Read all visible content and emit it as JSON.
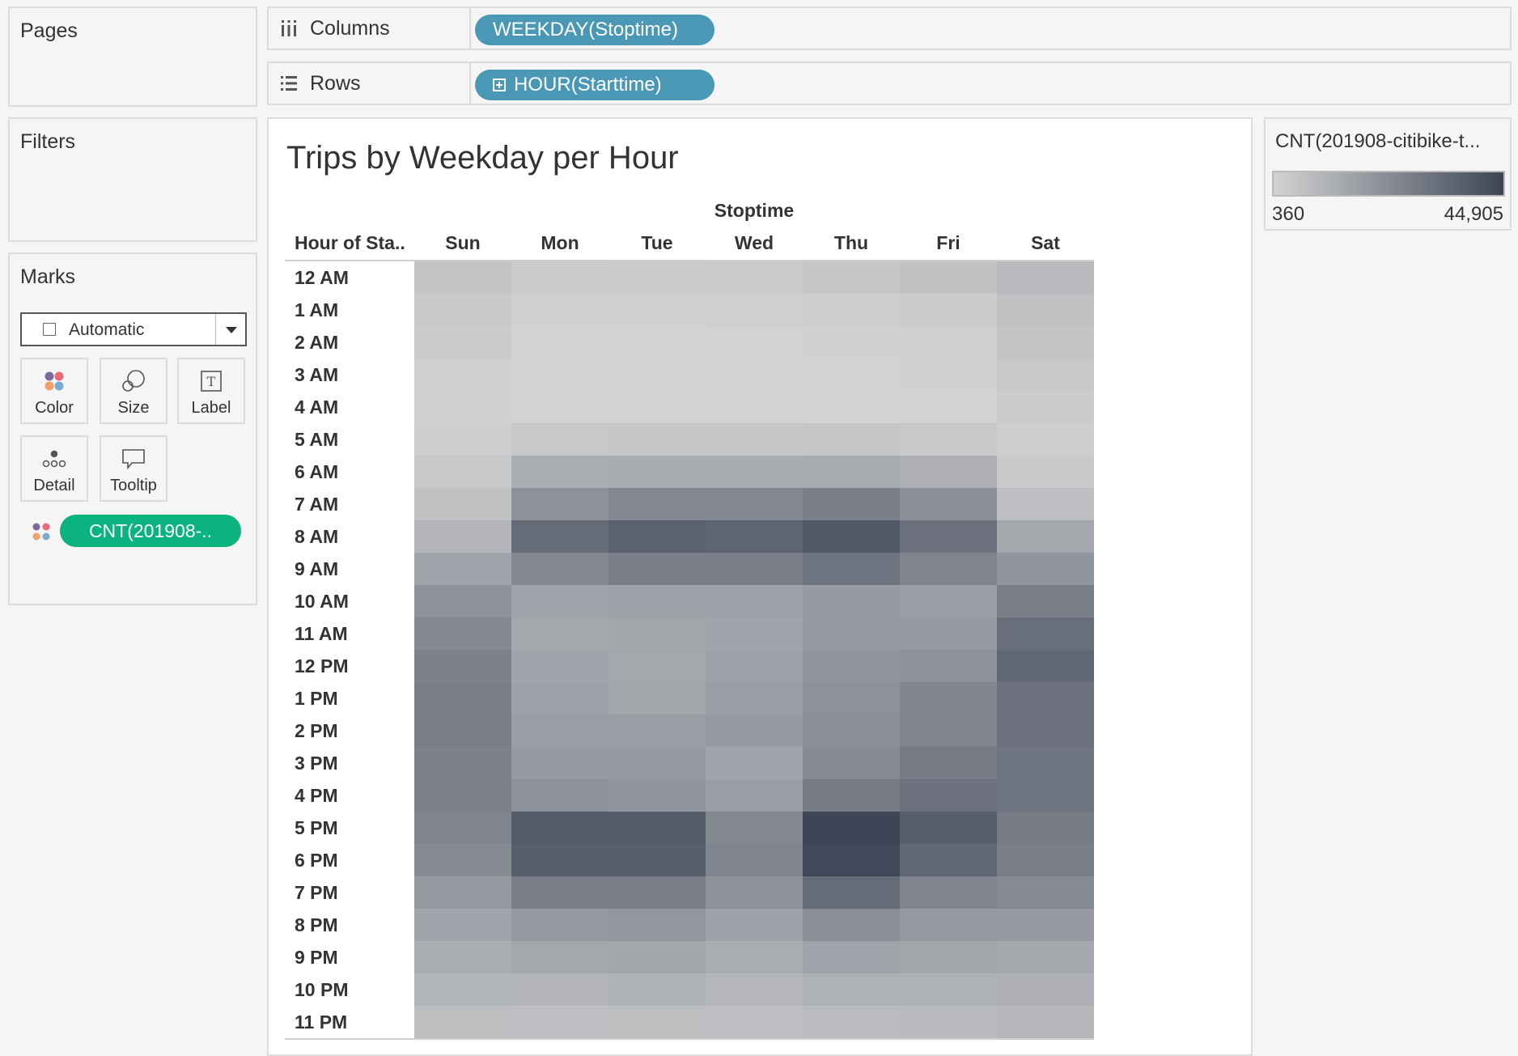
{
  "panels": {
    "pages": "Pages",
    "filters": "Filters",
    "marks": "Marks"
  },
  "shelves": {
    "columns": {
      "label": "Columns",
      "pill": "WEEKDAY(Stoptime)"
    },
    "rows": {
      "label": "Rows",
      "pill": "HOUR(Starttime)"
    }
  },
  "marks": {
    "type": "Automatic",
    "buttons": [
      "Color",
      "Size",
      "Label",
      "Detail",
      "Tooltip"
    ],
    "field_pill": "CNT(201908-.."
  },
  "legend": {
    "title": "CNT(201908-citibike-t...",
    "min_label": "360",
    "max_label": "44,905",
    "min_color": "#d2d3d3",
    "max_color": "#3d4556"
  },
  "chart_data": {
    "type": "heatmap",
    "title": "Trips by Weekday per Hour",
    "column_header": "Stoptime",
    "row_header": "Hour of Sta..",
    "x": [
      "Sun",
      "Mon",
      "Tue",
      "Wed",
      "Thu",
      "Fri",
      "Sat"
    ],
    "y": [
      "12 AM",
      "1 AM",
      "2 AM",
      "3 AM",
      "4 AM",
      "5 AM",
      "6 AM",
      "7 AM",
      "8 AM",
      "9 AM",
      "10 AM",
      "11 AM",
      "12 PM",
      "1 PM",
      "2 PM",
      "3 PM",
      "4 PM",
      "5 PM",
      "6 PM",
      "7 PM",
      "8 PM",
      "9 PM",
      "10 PM",
      "11 PM"
    ],
    "value_range": [
      360,
      44905
    ],
    "values": [
      [
        5000,
        2600,
        2900,
        3300,
        4500,
        5800,
        8500
      ],
      [
        3600,
        1200,
        1300,
        1500,
        2000,
        2800,
        6400
      ],
      [
        2500,
        700,
        700,
        800,
        1100,
        1500,
        5000
      ],
      [
        1700,
        450,
        420,
        500,
        700,
        900,
        3700
      ],
      [
        1400,
        600,
        550,
        600,
        700,
        800,
        2700
      ],
      [
        1800,
        3800,
        4200,
        4200,
        4300,
        3800,
        2000
      ],
      [
        3800,
        12000,
        13000,
        13000,
        13000,
        11500,
        3600
      ],
      [
        6000,
        21000,
        24000,
        24000,
        27000,
        22000,
        6500
      ],
      [
        10000,
        33000,
        36000,
        35000,
        39000,
        31000,
        14000
      ],
      [
        15000,
        24000,
        27000,
        27000,
        30000,
        25000,
        20000
      ],
      [
        21000,
        15000,
        16000,
        16000,
        18000,
        17000,
        27000
      ],
      [
        24000,
        14000,
        14500,
        15000,
        18500,
        18000,
        32000
      ],
      [
        26000,
        15000,
        14000,
        16000,
        20000,
        21000,
        34000
      ],
      [
        27000,
        16000,
        14500,
        17000,
        21000,
        24500,
        31000
      ],
      [
        27000,
        17000,
        17000,
        18000,
        21500,
        25000,
        31000
      ],
      [
        26000,
        18000,
        18500,
        15000,
        23000,
        27500,
        30000
      ],
      [
        26000,
        21000,
        20000,
        17000,
        28000,
        31000,
        30000
      ],
      [
        25000,
        38000,
        38000,
        24000,
        44905,
        37000,
        28000
      ],
      [
        23000,
        37000,
        37000,
        25000,
        44000,
        34000,
        27000
      ],
      [
        19000,
        27000,
        27000,
        21000,
        33000,
        25000,
        23000
      ],
      [
        15000,
        19000,
        19500,
        16000,
        22000,
        19000,
        18000
      ],
      [
        12000,
        14000,
        14500,
        12500,
        15500,
        14500,
        14000
      ],
      [
        9500,
        10000,
        10500,
        9000,
        11000,
        11000,
        11500
      ],
      [
        7000,
        6500,
        7000,
        6500,
        7500,
        8500,
        9000
      ]
    ]
  }
}
